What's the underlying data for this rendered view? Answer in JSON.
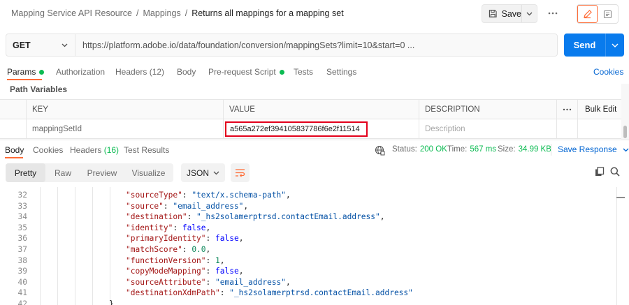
{
  "header": {
    "breadcrumb": [
      "Mapping Service API Resource",
      "Mappings",
      "Returns all mappings for a mapping set"
    ],
    "separator": "/",
    "save_label": "Save"
  },
  "request": {
    "method": "GET",
    "url": "https://platform.adobe.io/data/foundation/conversion/mappingSets?limit=10&start=0 ...",
    "send_label": "Send"
  },
  "request_tabs": [
    {
      "label": "Params",
      "active": true,
      "dot": true
    },
    {
      "label": "Authorization"
    },
    {
      "label": "Headers (12)"
    },
    {
      "label": "Body"
    },
    {
      "label": "Pre-request Script",
      "dot": true
    },
    {
      "label": "Tests"
    },
    {
      "label": "Settings"
    }
  ],
  "cookies_label": "Cookies",
  "path_variables": {
    "title": "Path Variables",
    "columns": {
      "key": "KEY",
      "value": "VALUE",
      "description": "DESCRIPTION",
      "bulk_edit": "Bulk Edit"
    },
    "row": {
      "key": "mappingSetId",
      "value": "a565a272ef394105837786f6e2f11514",
      "description_placeholder": "Description"
    }
  },
  "response": {
    "tabs": [
      {
        "label": "Body",
        "active": true
      },
      {
        "label": "Cookies"
      },
      {
        "label": "Headers",
        "count": "(16)"
      },
      {
        "label": "Test Results"
      }
    ],
    "status_label": "Status:",
    "status_value": "200 OK",
    "time_label": "Time:",
    "time_value": "567 ms",
    "size_label": "Size:",
    "size_value": "34.99 KB",
    "save_response_label": "Save Response",
    "formats": [
      "Pretty",
      "Raw",
      "Preview",
      "Visualize"
    ],
    "active_format": "Pretty",
    "language": "JSON"
  },
  "code_lines": [
    {
      "n": "32",
      "key": "\"sourceType\"",
      "val": "\"text/x.schema-path\"",
      "type": "s",
      "trail": ","
    },
    {
      "n": "33",
      "key": "\"source\"",
      "val": "\"email_address\"",
      "type": "s",
      "trail": ","
    },
    {
      "n": "34",
      "key": "\"destination\"",
      "val": "\"_hs2solamerptrsd.contactEmail.address\"",
      "type": "s",
      "trail": ","
    },
    {
      "n": "35",
      "key": "\"identity\"",
      "val": "false",
      "type": "b",
      "trail": ","
    },
    {
      "n": "36",
      "key": "\"primaryIdentity\"",
      "val": "false",
      "type": "b",
      "trail": ","
    },
    {
      "n": "37",
      "key": "\"matchScore\"",
      "val": "0.0",
      "type": "n",
      "trail": ","
    },
    {
      "n": "38",
      "key": "\"functionVersion\"",
      "val": "1",
      "type": "n",
      "trail": ","
    },
    {
      "n": "39",
      "key": "\"copyModeMapping\"",
      "val": "false",
      "type": "b",
      "trail": ","
    },
    {
      "n": "40",
      "key": "\"sourceAttribute\"",
      "val": "\"email_address\"",
      "type": "s",
      "trail": ","
    },
    {
      "n": "41",
      "key": "\"destinationXdmPath\"",
      "val": "\"_hs2solamerptrsd.contactEmail.address\"",
      "type": "s",
      "trail": ""
    },
    {
      "n": "42",
      "close": "},"
    }
  ],
  "colors": {
    "accent": "#ff6c37",
    "send": "#097bed",
    "link": "#0265d2",
    "status_ok": "#0cbb52",
    "highlight_box": "#e3001b"
  }
}
